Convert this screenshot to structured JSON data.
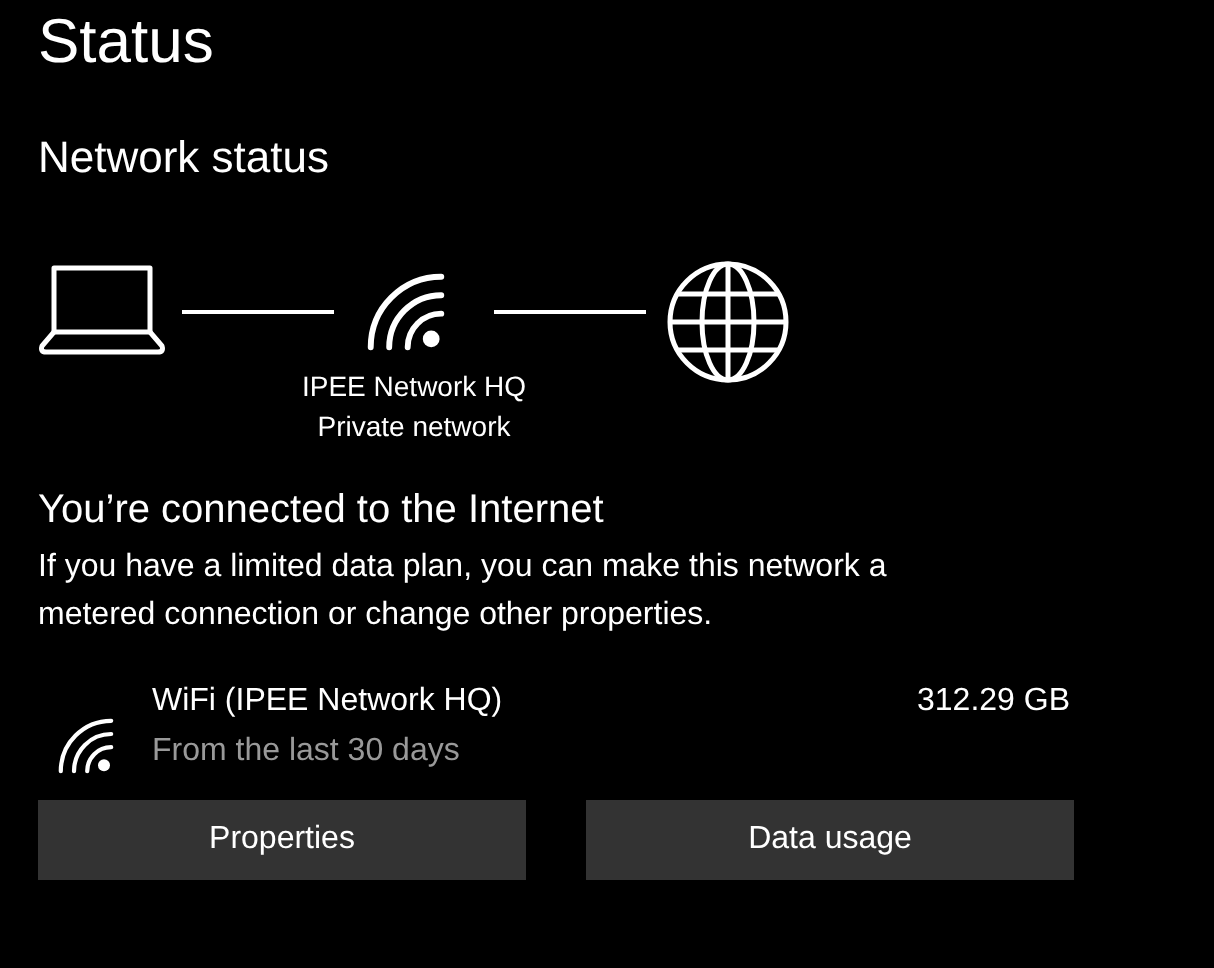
{
  "page": {
    "title": "Status"
  },
  "section": {
    "title": "Network status"
  },
  "network": {
    "name": "IPEE Network HQ",
    "type": "Private network"
  },
  "connection": {
    "heading": "You’re connected to the Internet",
    "description": "If you have a limited data plan, you can make this network a metered connection or change other properties."
  },
  "usage": {
    "adapter": "WiFi (IPEE Network HQ)",
    "period": "From the last 30 days",
    "amount": "312.29 GB"
  },
  "buttons": [
    "Properties",
    "Data usage"
  ]
}
